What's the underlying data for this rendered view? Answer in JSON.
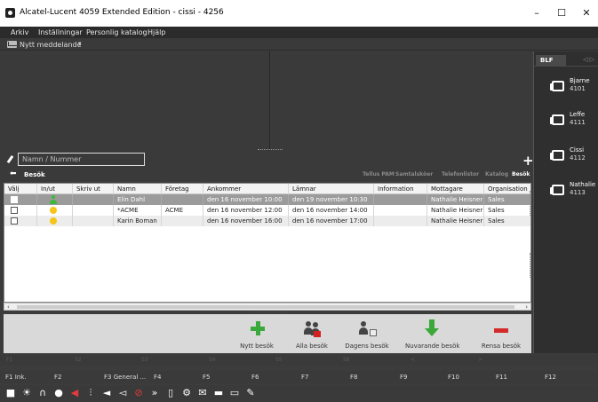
{
  "window": {
    "title": "Alcatel-Lucent 4059 Extended Edition - cissi - 4256",
    "minimize": "–",
    "maximize": "☐",
    "close": "✕"
  },
  "menu": [
    "Arkiv",
    "Inställningar",
    "Personlig katalog",
    "Hjälp"
  ],
  "toolbar": {
    "new_message": "Nytt meddelande"
  },
  "blf": {
    "tab": "BLF",
    "arrows": "◁ ▷",
    "items": [
      {
        "name": "Bjarne",
        "ext": "4101"
      },
      {
        "name": "Leffe",
        "ext": "4111"
      },
      {
        "name": "Cissi",
        "ext": "4112"
      },
      {
        "name": "Nathalie",
        "ext": "4113"
      }
    ]
  },
  "search": {
    "placeholder": "Namn / Nummer"
  },
  "section": {
    "title": "Besök",
    "tabs": [
      "Tellus PAM",
      "Samtalsköer",
      "Telefonlistor",
      "Katalog",
      "Besök"
    ],
    "active_tab": "Besök"
  },
  "table": {
    "columns": [
      "Välj",
      "In/ut",
      "Skriv ut",
      "Namn",
      "Företag",
      "Ankommer",
      "Lämnar",
      "Information",
      "Mottagare",
      "Organisation"
    ],
    "rows": [
      {
        "namn": "Elin Dahl",
        "foretag": "",
        "ankommer": "den 16 november 10:00",
        "lamnar": "den 19 november 10:30",
        "information": "",
        "mottagare": "Nathalie Heisner",
        "organisation": "Sales",
        "status": "in"
      },
      {
        "namn": "*ACME",
        "foretag": "ACME",
        "ankommer": "den 16 november 12:00",
        "lamnar": "den 16 november 14:00",
        "information": "",
        "mottagare": "Nathalie Heisner",
        "organisation": "Sales",
        "status": "expected"
      },
      {
        "namn": "Karin Boman",
        "foretag": "",
        "ankommer": "den 16 november 16:00",
        "lamnar": "den 16 november 17:00",
        "information": "",
        "mottagare": "Nathalie Heisner",
        "organisation": "Sales",
        "status": "expected"
      }
    ]
  },
  "actions": [
    "Nytt besök",
    "Alla besök",
    "Dagens besök",
    "Nuvarande besök",
    "Rensa besök"
  ],
  "fkeys_ghost": [
    "F1",
    "S2",
    "S3",
    "S4",
    "S5",
    "S6",
    "<",
    ">"
  ],
  "fkeys": [
    "F1 Ink.",
    "F2",
    "F3 General ...",
    "F4",
    "F5",
    "F6",
    "F7",
    "F8",
    "F9",
    "F10",
    "F11",
    "F12"
  ],
  "colors": {
    "in": "#3db83d",
    "expected": "#f5c518",
    "selected_row": "#9b9b9b"
  },
  "bottom_icons": [
    "stop-icon",
    "brightness-icon",
    "headset-icon",
    "microphone-icon",
    "mute-speaker-icon",
    "signal-icon",
    "volume-down-icon",
    "volume-up-icon",
    "no-call-icon",
    "forward-icon",
    "book-icon",
    "settings-icon",
    "mail-icon",
    "chat-icon",
    "inbox-icon",
    "edit-icon"
  ]
}
